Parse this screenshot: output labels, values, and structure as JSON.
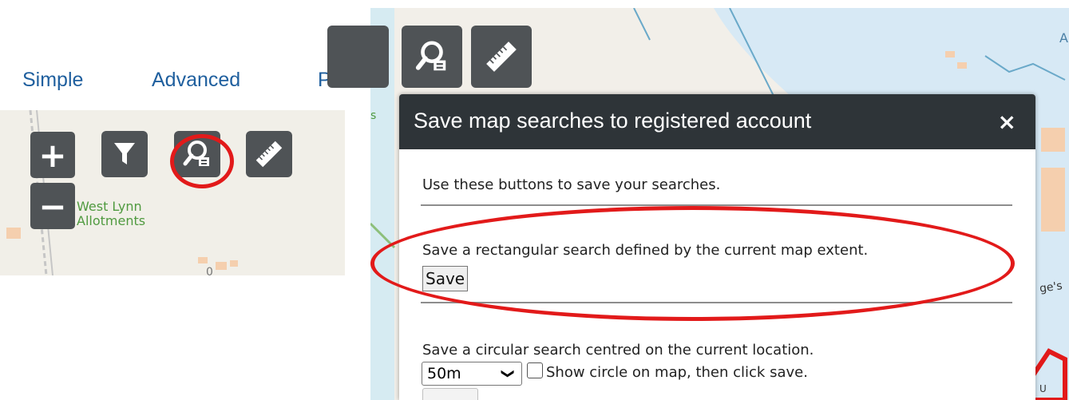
{
  "left_panel": {
    "tabs": [
      "Simple",
      "Advanced",
      "Pr"
    ],
    "zoom_in": "+",
    "zoom_out": "−",
    "map_label_line1": "West Lynn",
    "map_label_line2": "Allotments",
    "map_label_extra": "0",
    "icons": [
      "filter-icon",
      "saved-search-icon",
      "measure-ruler-icon"
    ]
  },
  "right_panel": {
    "map_label_a": "A",
    "map_label_s": "s",
    "map_label_ge": "ge's",
    "map_label_u": "U",
    "dialog": {
      "title": "Save map searches to registered account",
      "close": "×",
      "intro": "Use these buttons to save your searches.",
      "rect_text": "Save a rectangular search defined by the current map extent.",
      "save_label": "Save",
      "circle_text": "Save a circular search centred on the current location.",
      "radius_value": "50m",
      "show_circle_label": "Show circle on map, then click save."
    }
  },
  "colors": {
    "tab_link": "#1f5f9e",
    "button_bg": "#4f5356",
    "dialog_header": "#2e3438",
    "highlight": "#e21a1a",
    "water": "#cfe6f3",
    "map_bg": "#f2efe9"
  }
}
